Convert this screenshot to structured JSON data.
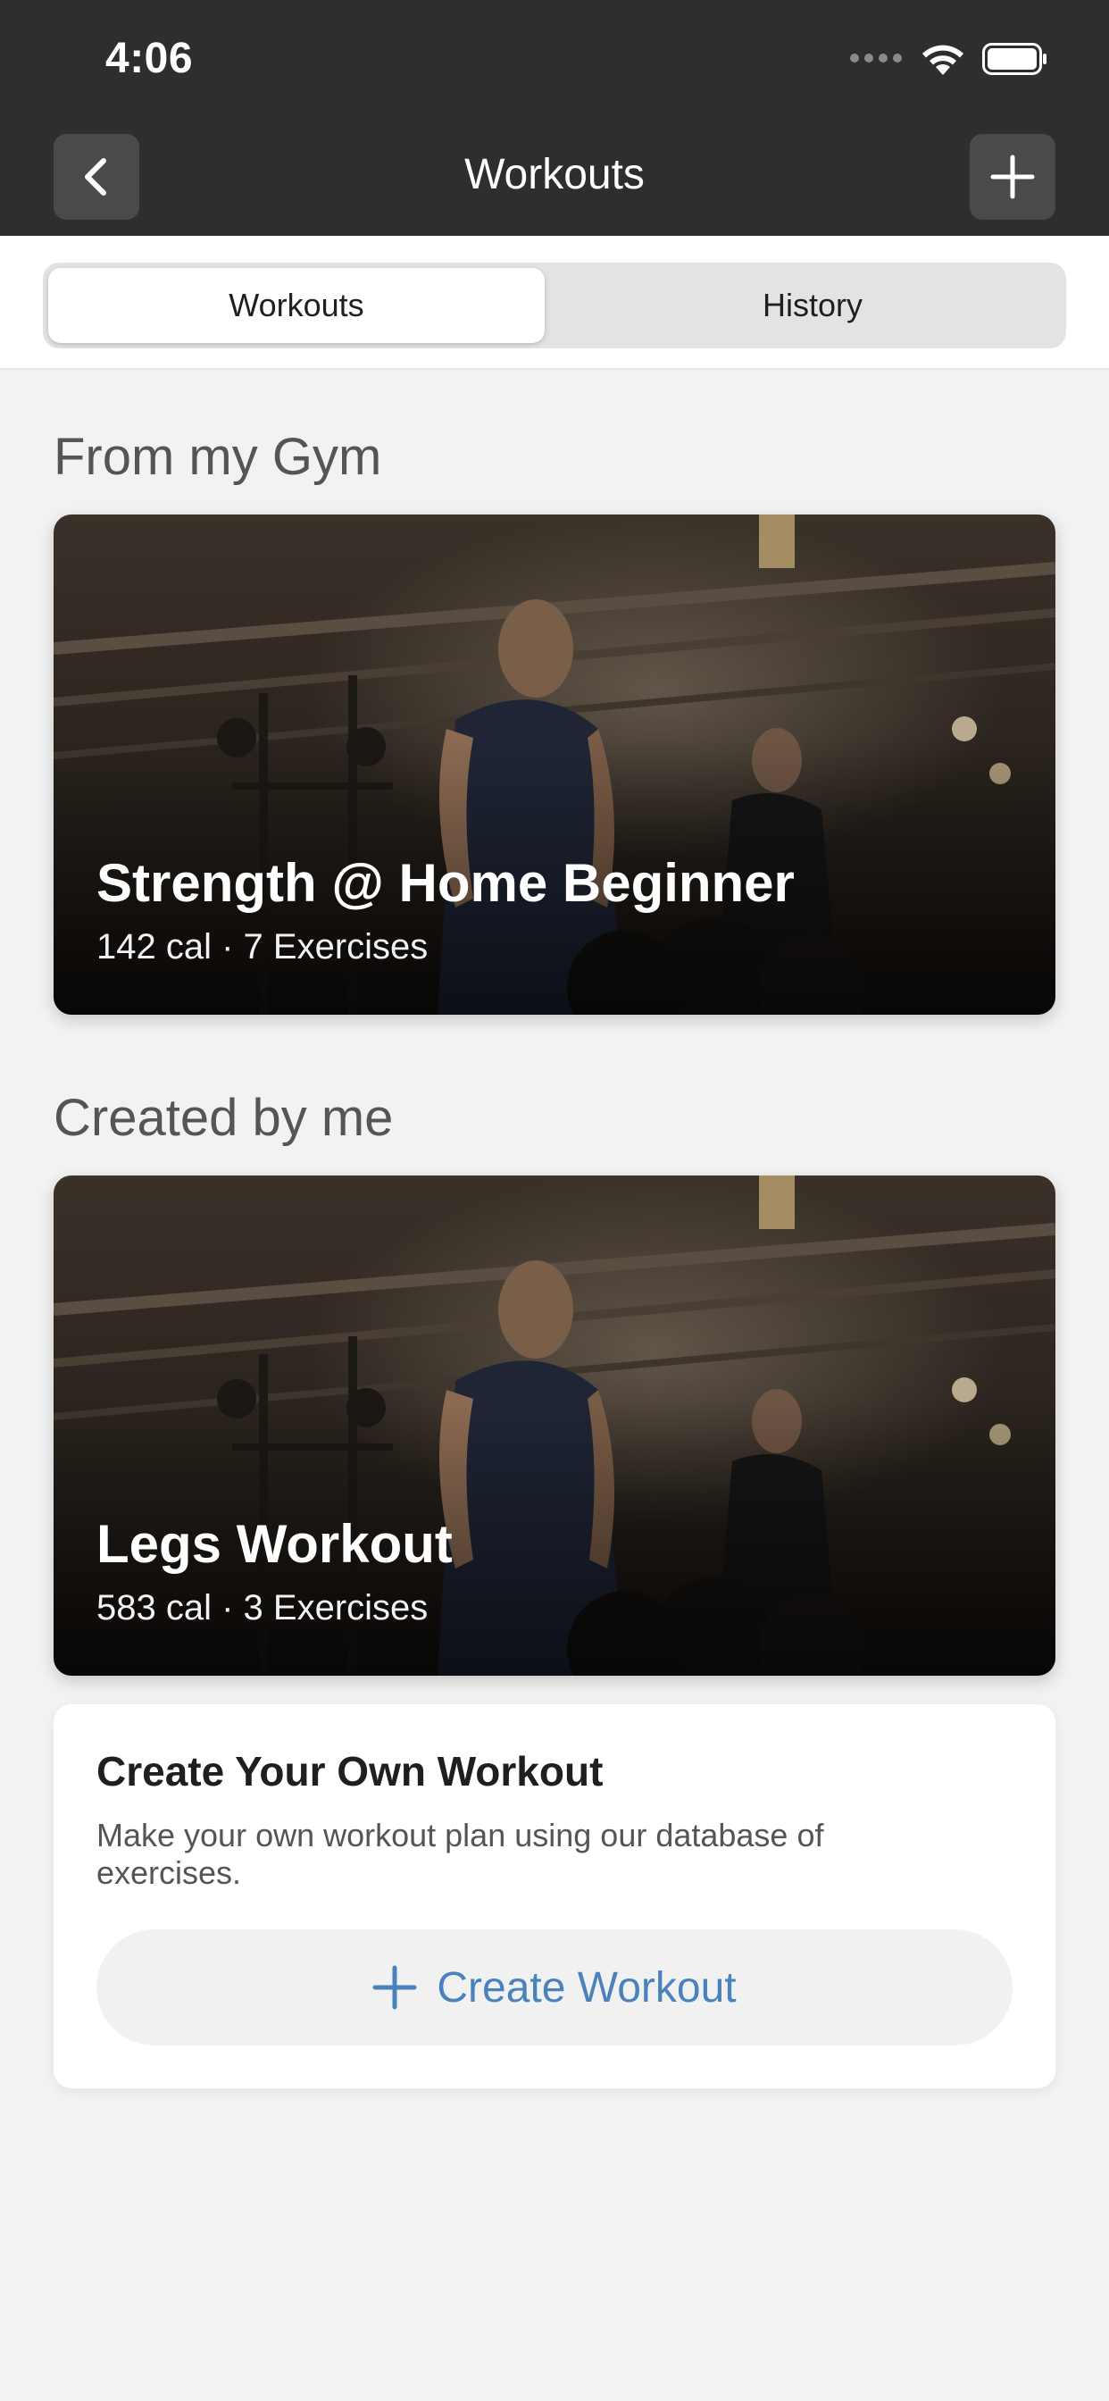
{
  "status_bar": {
    "time": "4:06"
  },
  "header": {
    "title": "Workouts",
    "back_icon": "chevron-left-icon",
    "add_icon": "plus-icon"
  },
  "tabs": [
    {
      "label": "Workouts",
      "active": true
    },
    {
      "label": "History",
      "active": false
    }
  ],
  "sections": {
    "gym": {
      "title": "From my Gym",
      "card": {
        "title": "Strength @ Home Beginner",
        "meta": "142 cal · 7 Exercises"
      }
    },
    "mine": {
      "title": "Created by me",
      "card": {
        "title": "Legs Workout",
        "meta": "583 cal · 3 Exercises"
      }
    }
  },
  "create": {
    "title": "Create Your Own Workout",
    "description": "Make your own workout plan using our database of exercises.",
    "button_label": "Create Workout",
    "button_icon": "plus-icon"
  },
  "colors": {
    "header_bg": "#2e2e2f",
    "page_bg": "#f2f2f2",
    "accent": "#4a82bd"
  }
}
